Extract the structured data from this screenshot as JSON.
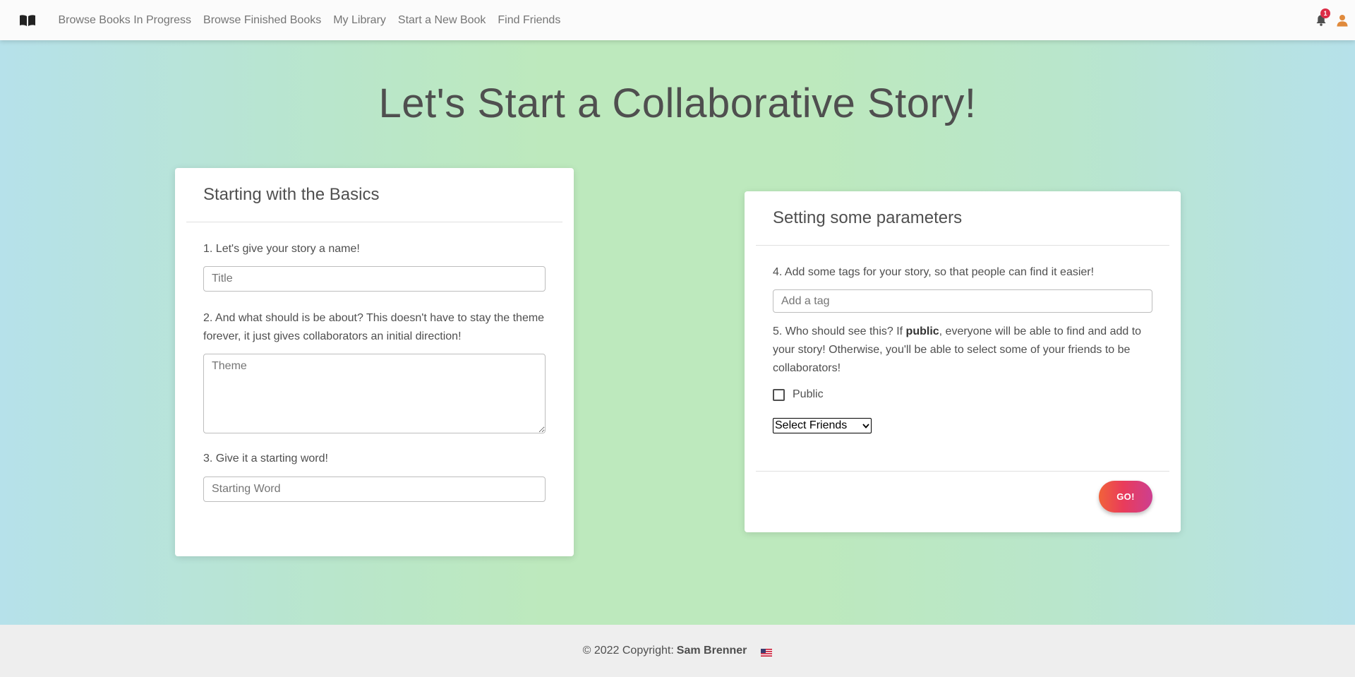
{
  "nav": {
    "brand_icon": "open-book-icon",
    "links": [
      "Browse Books In Progress",
      "Browse Finished Books",
      "My Library",
      "Start a New Book",
      "Find Friends"
    ],
    "notification_count": "1",
    "bell_icon": "bell-icon",
    "user_icon": "user-icon"
  },
  "page": {
    "title": "Let's Start a Collaborative Story!"
  },
  "basics": {
    "header": "Starting with the Basics",
    "q1": "1. Let's give your story a name!",
    "title_placeholder": "Title",
    "q2": "2. And what should is be about? This doesn't have to stay the theme forever, it just gives collaborators an initial direction!",
    "theme_placeholder": "Theme",
    "q3": "3. Give it a starting word!",
    "word_placeholder": "Starting Word"
  },
  "parameters": {
    "header": "Setting some parameters",
    "q4": "4. Add some tags for your story, so that people can find it easier!",
    "tag_placeholder": "Add a tag",
    "q5_before": "5. Who should see this? If ",
    "q5_bold": "public",
    "q5_after": ", everyone will be able to find and add to your story! Otherwise, you'll be able to select some of your friends to be collaborators!",
    "public_label": "Public",
    "public_checked": false,
    "friends_select_value": "Select Friends",
    "go_label": "GO!"
  },
  "footer": {
    "copyright": "© 2022 Copyright:",
    "author": "Sam Brenner",
    "flag_icon": "us-flag-icon"
  },
  "colors": {
    "accent_gradient_start": "#f1623a",
    "accent_gradient_end": "#cd3f90",
    "background_green": "#bde9bd",
    "background_blue": "#b6e1ea",
    "badge": "#dc2d47",
    "user_icon": "#e08a3c"
  }
}
